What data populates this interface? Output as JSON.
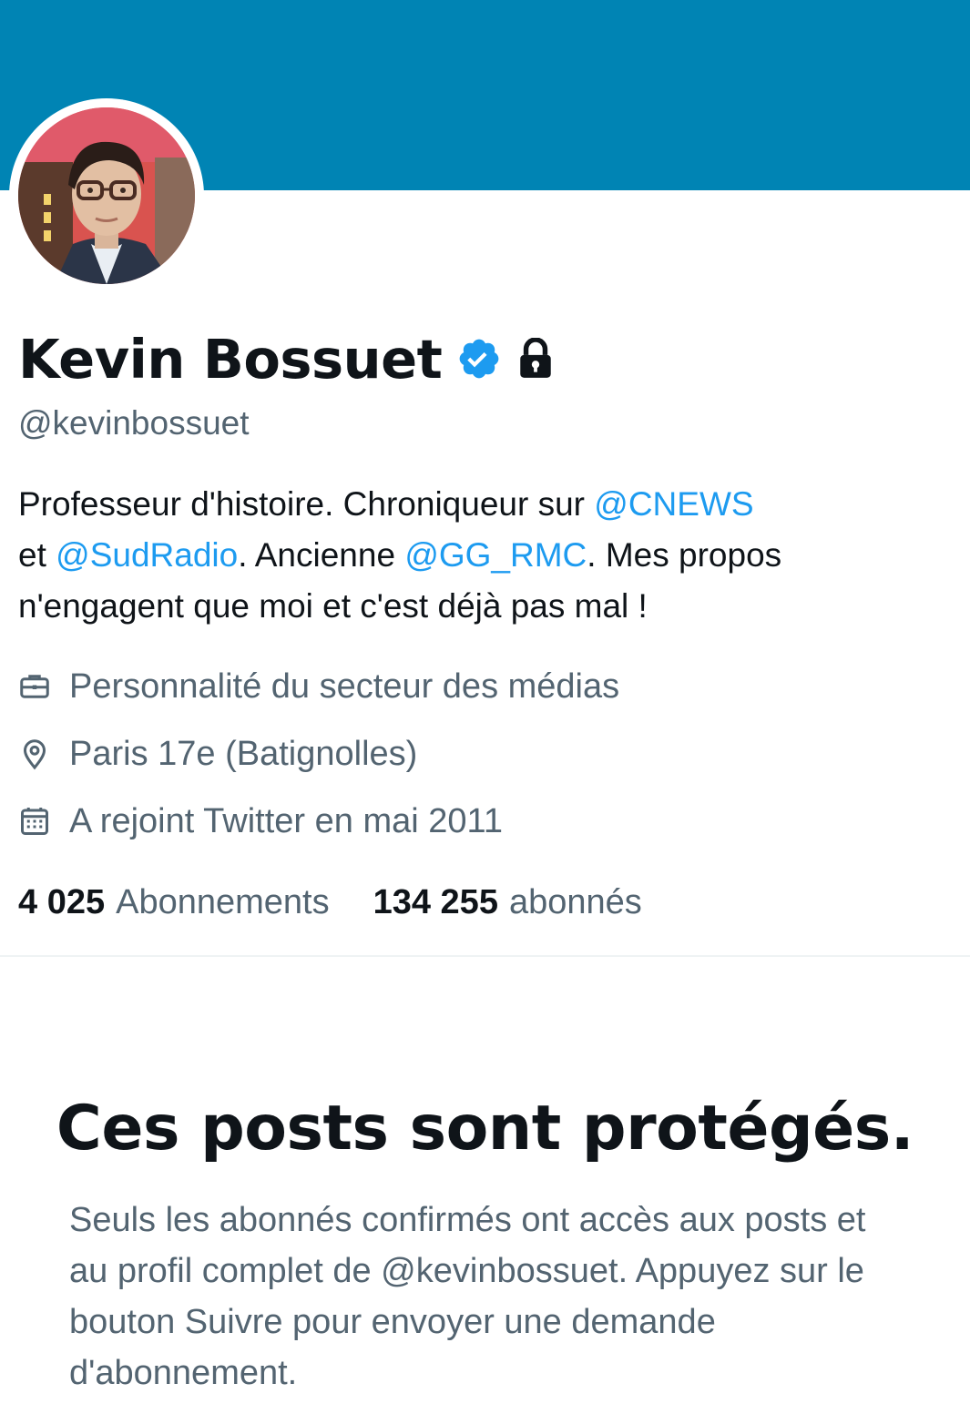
{
  "profile": {
    "display_name": "Kevin Bossuet",
    "handle": "@kevinbossuet",
    "verified_icon": "verified-badge-icon",
    "protected_icon": "lock-icon",
    "colors": {
      "banner": "#0084b4",
      "accent": "#1d9bf0",
      "secondary_text": "#536471",
      "primary_text": "#0f1419"
    }
  },
  "bio": {
    "part1": "Professeur d'histoire. Chroniqueur sur ",
    "mention1": "@CNEWS",
    "part2": " et ",
    "mention2": "@SudRadio",
    "part3": ". Ancienne ",
    "mention3": "@GG_RMC",
    "part4": ". Mes propos n'engagent que moi et c'est déjà pas mal !"
  },
  "meta": {
    "category": "Personnalité du secteur des médias",
    "location": "Paris 17e (Batignolles)",
    "joined": "A rejoint Twitter en mai 2011"
  },
  "stats": {
    "following_count": "4 025",
    "following_label": "Abonnements",
    "followers_count": "134 255",
    "followers_label": "abonnés"
  },
  "protected": {
    "title": "Ces posts sont protégés.",
    "text": "Seuls les abonnés confirmés ont accès aux posts et au profil complet de @kevinbossuet. Appuyez sur le bouton Suivre pour envoyer une demande d'abonnement."
  }
}
